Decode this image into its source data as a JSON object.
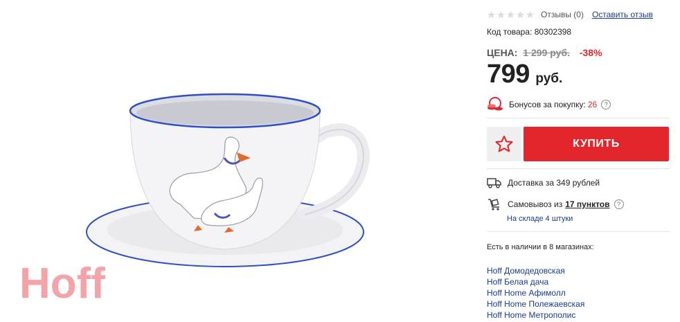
{
  "brand": {
    "logo_text": "Hoff",
    "logo_color": "#f4a3a8"
  },
  "rating": {
    "stars_total": 5,
    "stars_filled": 0,
    "reviews_label": "Отзывы (0)",
    "leave_review": "Оставить отзыв"
  },
  "product": {
    "code_label": "Код товара: 80302398"
  },
  "price": {
    "label": "ЦЕНА:",
    "old_price": "1 299 руб.",
    "discount": "-38%",
    "current": "799",
    "currency": "руб."
  },
  "bonus": {
    "label": "Бонусов за покупку:",
    "value": "26",
    "help": "?"
  },
  "actions": {
    "buy_label": "КУПИТЬ"
  },
  "delivery": {
    "label": "Доставка за 349 рублей"
  },
  "pickup": {
    "label": "Самовывоз из",
    "count": "17 пунктов",
    "help": "?",
    "stock_note": "На складе 4 штуки"
  },
  "stores": {
    "title": "Есть в наличии в 8 магазинах:",
    "items": [
      "Hoff Домодедовская",
      "Hoff Белая дача",
      "Hoff Home Афимолл",
      "Hoff Home Полежаевская",
      "Hoff Home Метрополис"
    ]
  },
  "colors": {
    "accent": "#e3262b",
    "link": "#1a3c8c",
    "cup_rim": "#2f4fc4"
  }
}
